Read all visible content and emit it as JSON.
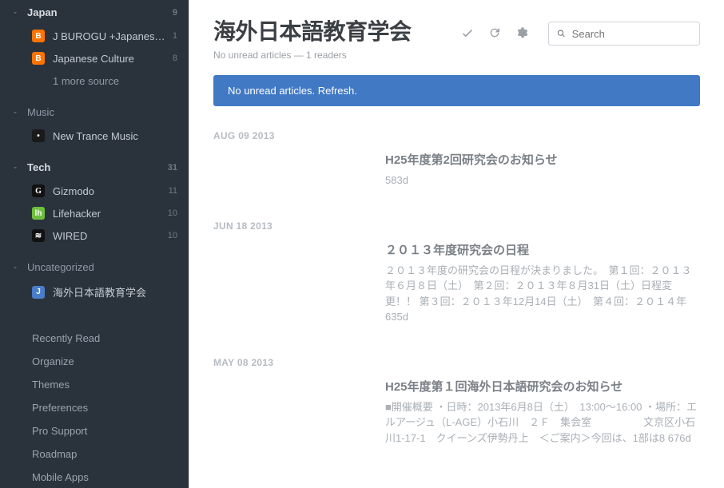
{
  "sidebar": {
    "folders": [
      {
        "name": "Japan",
        "bold": true,
        "count": "9",
        "feeds": [
          {
            "label": "J BUROGU +Japanes…",
            "count": "1",
            "fav": "blogger"
          },
          {
            "label": "Japanese Culture",
            "count": "8",
            "fav": "blogger"
          }
        ],
        "more": "1 more source"
      },
      {
        "name": "Music",
        "bold": false,
        "count": "",
        "feeds": [
          {
            "label": "New Trance Music",
            "count": "",
            "fav": "dark"
          }
        ]
      },
      {
        "name": "Tech",
        "bold": true,
        "count": "31",
        "feeds": [
          {
            "label": "Gizmodo",
            "count": "11",
            "fav": "g"
          },
          {
            "label": "Lifehacker",
            "count": "10",
            "fav": "lh"
          },
          {
            "label": "WIRED",
            "count": "10",
            "fav": "wired"
          }
        ]
      },
      {
        "name": "Uncategorized",
        "bold": false,
        "count": "",
        "feeds": [
          {
            "label": "海外日本語教育学会",
            "count": "",
            "fav": "j"
          }
        ]
      }
    ],
    "footer": [
      "Recently Read",
      "Organize",
      "Themes",
      "Preferences",
      "Pro Support",
      "Roadmap",
      "Mobile Apps"
    ]
  },
  "header": {
    "title": "海外日本語教育学会",
    "subtitle": "No unread articles — 1 readers",
    "search_placeholder": "Search"
  },
  "notice": "No unread articles. Refresh.",
  "groups": [
    {
      "date": "AUG 09 2013",
      "articles": [
        {
          "title": "H25年度第2回研究会のお知らせ",
          "excerpt": "",
          "age": "583d"
        }
      ]
    },
    {
      "date": "JUN 18 2013",
      "articles": [
        {
          "title": "２０１３年度研究会の日程",
          "excerpt": "２０１３年度の研究会の日程が決まりました。　第１回：２０１３年６月８日（土）　第２回：２０１３年８月31日（土）日程変更！！ 第３回：２０１３年12月14日（土）　第４回：２０１４年",
          "age": "635d"
        }
      ]
    },
    {
      "date": "MAY 08 2013",
      "articles": [
        {
          "title": "H25年度第１回海外日本語研究会のお知らせ",
          "excerpt": "■開催概要 ・日時：2013年6月8日（土）　13:00～16:00 ・場所：エルアージュ（L-AGE）小石川　２Ｆ　集会室　　　　　文京区小石川1-17-1　クイーンズ伊勢丹上　＜ご案内＞今回は、1部は8",
          "age": "676d"
        }
      ]
    }
  ]
}
